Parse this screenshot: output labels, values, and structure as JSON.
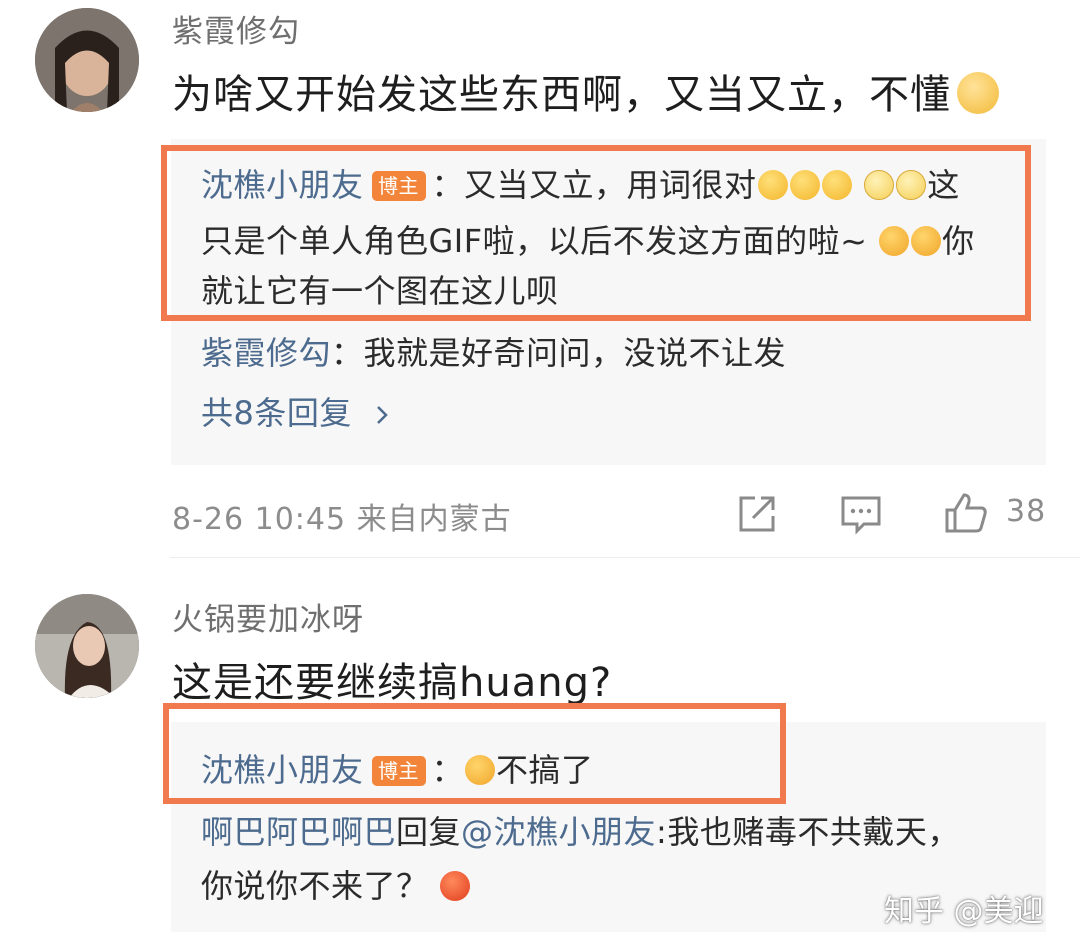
{
  "comments": [
    {
      "username": "紫霞修勾",
      "text": "为啥又开始发这些东西啊，又当又立，不懂",
      "text_emoji": "raised-eyebrow-emoji",
      "replies": {
        "r1_user": "沈樵小朋友",
        "badge": "博主",
        "r1_line1": "：又当又立，用词很对",
        "r1_line1_end": "这",
        "r1_line2": "只是个单人角色GIF啦，以后不发这方面的啦~",
        "r1_line2_end": "你",
        "r1_line3": "就让它有一个图在这儿呗",
        "r2_user": "紫霞修勾",
        "r2_text": "：我就是好奇问问，没说不让发",
        "more_label": "共8条回复",
        "more_icon": "chevron-right-icon"
      },
      "meta": "8-26 10:45  来自内蒙古",
      "actions": {
        "share_icon": "share-icon",
        "comment_icon": "comment-icon",
        "like_icon": "thumbs-up-icon",
        "like_count": "38"
      }
    },
    {
      "username": "火锅要加冰呀",
      "text": "这是还要继续搞huang?",
      "replies": {
        "r1_user": "沈樵小朋友",
        "badge": "博主",
        "r1_sep": "：",
        "r1_text": "不搞了",
        "r2_user": "啊巴阿巴啊巴",
        "r2_reply_word": "回复",
        "r2_mention": "@沈樵小朋友",
        "r2_text": ":我也赌毒不共戴天，",
        "r2_line2": "你说你不来了？"
      }
    }
  ],
  "watermark": "知乎 @美迎",
  "colors": {
    "highlight": "#f07a4e",
    "badge": "#f2853a",
    "link": "#4d6b8e",
    "reply_bg": "#f7f7f7"
  }
}
